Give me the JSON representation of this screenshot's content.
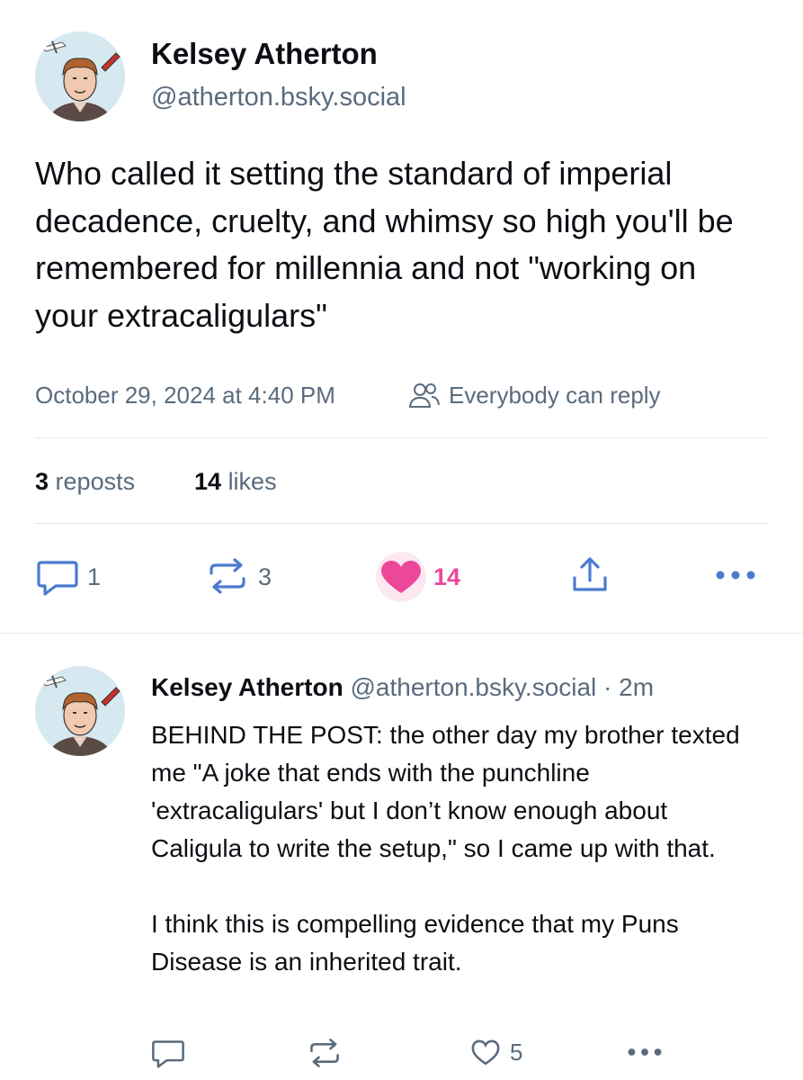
{
  "post": {
    "author_name": "Kelsey Atherton",
    "author_handle": "@atherton.bsky.social",
    "text": "Who called it setting the standard of imperial decadence, cruelty, and whimsy so high you'll be remembered for millennia and not \"working on your extracaligulars\"",
    "timestamp": "October 29, 2024 at 4:40 PM",
    "reply_setting": "Everybody can reply",
    "stats": {
      "reposts_count": "3",
      "reposts_label": "reposts",
      "likes_count": "14",
      "likes_label": "likes"
    },
    "actions": {
      "reply_count": "1",
      "repost_count": "3",
      "like_count": "14"
    }
  },
  "reply": {
    "author_name": "Kelsey Atherton",
    "author_handle": "@atherton.bsky.social",
    "time": "· 2m",
    "paragraph1": "BEHIND THE POST: the other day my brother texted me \"A joke that ends with the punchline 'extracaligulars' but I don’t know enough about Caligula to write the setup,\" so I came up with that.",
    "paragraph2": "I think this is compelling evidence that my Puns Disease is an inherited trait.",
    "actions": {
      "like_count": "5"
    }
  },
  "colors": {
    "text": "#0b0f14",
    "muted": "#5a6b7d",
    "icon": "#4a7bd0",
    "like": "#ec4899",
    "divider": "#e3e8ee"
  }
}
